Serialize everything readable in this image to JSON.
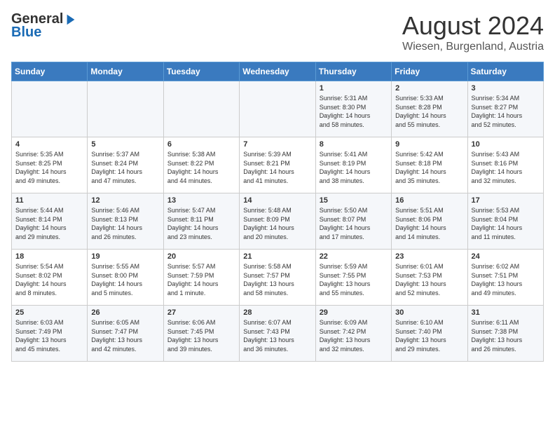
{
  "header": {
    "logo_line1": "General",
    "logo_line2": "Blue",
    "month_year": "August 2024",
    "location": "Wiesen, Burgenland, Austria"
  },
  "weekdays": [
    "Sunday",
    "Monday",
    "Tuesday",
    "Wednesday",
    "Thursday",
    "Friday",
    "Saturday"
  ],
  "weeks": [
    [
      {
        "day": "",
        "info": ""
      },
      {
        "day": "",
        "info": ""
      },
      {
        "day": "",
        "info": ""
      },
      {
        "day": "",
        "info": ""
      },
      {
        "day": "1",
        "info": "Sunrise: 5:31 AM\nSunset: 8:30 PM\nDaylight: 14 hours\nand 58 minutes."
      },
      {
        "day": "2",
        "info": "Sunrise: 5:33 AM\nSunset: 8:28 PM\nDaylight: 14 hours\nand 55 minutes."
      },
      {
        "day": "3",
        "info": "Sunrise: 5:34 AM\nSunset: 8:27 PM\nDaylight: 14 hours\nand 52 minutes."
      }
    ],
    [
      {
        "day": "4",
        "info": "Sunrise: 5:35 AM\nSunset: 8:25 PM\nDaylight: 14 hours\nand 49 minutes."
      },
      {
        "day": "5",
        "info": "Sunrise: 5:37 AM\nSunset: 8:24 PM\nDaylight: 14 hours\nand 47 minutes."
      },
      {
        "day": "6",
        "info": "Sunrise: 5:38 AM\nSunset: 8:22 PM\nDaylight: 14 hours\nand 44 minutes."
      },
      {
        "day": "7",
        "info": "Sunrise: 5:39 AM\nSunset: 8:21 PM\nDaylight: 14 hours\nand 41 minutes."
      },
      {
        "day": "8",
        "info": "Sunrise: 5:41 AM\nSunset: 8:19 PM\nDaylight: 14 hours\nand 38 minutes."
      },
      {
        "day": "9",
        "info": "Sunrise: 5:42 AM\nSunset: 8:18 PM\nDaylight: 14 hours\nand 35 minutes."
      },
      {
        "day": "10",
        "info": "Sunrise: 5:43 AM\nSunset: 8:16 PM\nDaylight: 14 hours\nand 32 minutes."
      }
    ],
    [
      {
        "day": "11",
        "info": "Sunrise: 5:44 AM\nSunset: 8:14 PM\nDaylight: 14 hours\nand 29 minutes."
      },
      {
        "day": "12",
        "info": "Sunrise: 5:46 AM\nSunset: 8:13 PM\nDaylight: 14 hours\nand 26 minutes."
      },
      {
        "day": "13",
        "info": "Sunrise: 5:47 AM\nSunset: 8:11 PM\nDaylight: 14 hours\nand 23 minutes."
      },
      {
        "day": "14",
        "info": "Sunrise: 5:48 AM\nSunset: 8:09 PM\nDaylight: 14 hours\nand 20 minutes."
      },
      {
        "day": "15",
        "info": "Sunrise: 5:50 AM\nSunset: 8:07 PM\nDaylight: 14 hours\nand 17 minutes."
      },
      {
        "day": "16",
        "info": "Sunrise: 5:51 AM\nSunset: 8:06 PM\nDaylight: 14 hours\nand 14 minutes."
      },
      {
        "day": "17",
        "info": "Sunrise: 5:53 AM\nSunset: 8:04 PM\nDaylight: 14 hours\nand 11 minutes."
      }
    ],
    [
      {
        "day": "18",
        "info": "Sunrise: 5:54 AM\nSunset: 8:02 PM\nDaylight: 14 hours\nand 8 minutes."
      },
      {
        "day": "19",
        "info": "Sunrise: 5:55 AM\nSunset: 8:00 PM\nDaylight: 14 hours\nand 5 minutes."
      },
      {
        "day": "20",
        "info": "Sunrise: 5:57 AM\nSunset: 7:59 PM\nDaylight: 14 hours\nand 1 minute."
      },
      {
        "day": "21",
        "info": "Sunrise: 5:58 AM\nSunset: 7:57 PM\nDaylight: 13 hours\nand 58 minutes."
      },
      {
        "day": "22",
        "info": "Sunrise: 5:59 AM\nSunset: 7:55 PM\nDaylight: 13 hours\nand 55 minutes."
      },
      {
        "day": "23",
        "info": "Sunrise: 6:01 AM\nSunset: 7:53 PM\nDaylight: 13 hours\nand 52 minutes."
      },
      {
        "day": "24",
        "info": "Sunrise: 6:02 AM\nSunset: 7:51 PM\nDaylight: 13 hours\nand 49 minutes."
      }
    ],
    [
      {
        "day": "25",
        "info": "Sunrise: 6:03 AM\nSunset: 7:49 PM\nDaylight: 13 hours\nand 45 minutes."
      },
      {
        "day": "26",
        "info": "Sunrise: 6:05 AM\nSunset: 7:47 PM\nDaylight: 13 hours\nand 42 minutes."
      },
      {
        "day": "27",
        "info": "Sunrise: 6:06 AM\nSunset: 7:45 PM\nDaylight: 13 hours\nand 39 minutes."
      },
      {
        "day": "28",
        "info": "Sunrise: 6:07 AM\nSunset: 7:43 PM\nDaylight: 13 hours\nand 36 minutes."
      },
      {
        "day": "29",
        "info": "Sunrise: 6:09 AM\nSunset: 7:42 PM\nDaylight: 13 hours\nand 32 minutes."
      },
      {
        "day": "30",
        "info": "Sunrise: 6:10 AM\nSunset: 7:40 PM\nDaylight: 13 hours\nand 29 minutes."
      },
      {
        "day": "31",
        "info": "Sunrise: 6:11 AM\nSunset: 7:38 PM\nDaylight: 13 hours\nand 26 minutes."
      }
    ]
  ]
}
